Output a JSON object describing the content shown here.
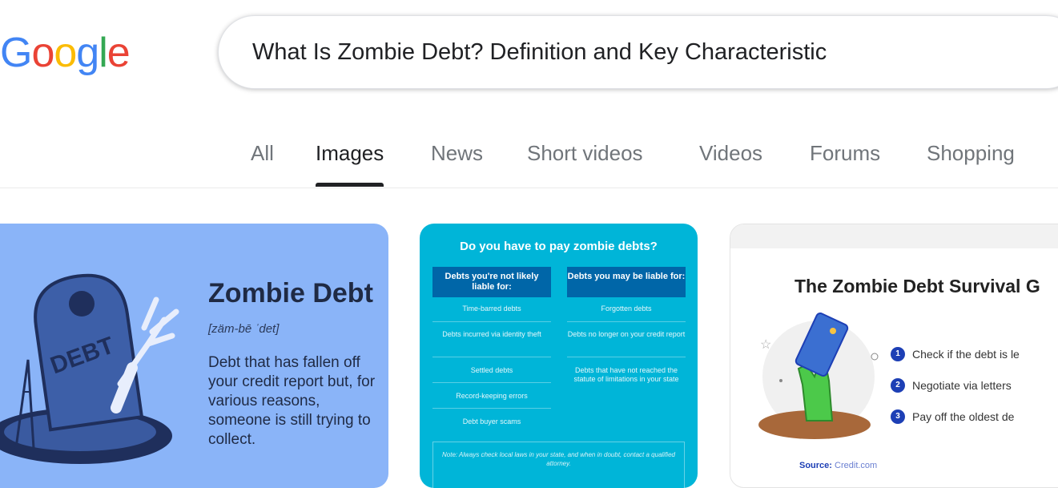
{
  "logo": {
    "b1": "G",
    "o1": "o",
    "o2": "o",
    "g": "g",
    "l": "l",
    "e": "e"
  },
  "search": {
    "query": "What Is Zombie Debt? Definition and Key Characteristic"
  },
  "tabs": [
    {
      "label": "All"
    },
    {
      "label": "Images"
    },
    {
      "label": "News"
    },
    {
      "label": "Short videos"
    },
    {
      "label": "Videos"
    },
    {
      "label": "Forums"
    },
    {
      "label": "Shopping"
    }
  ],
  "results": {
    "card1": {
      "title": "Zombie Debt",
      "pronunciation": "[zäm-bē ˈdet]",
      "definition": "Debt that has fallen off your credit report but, for various reasons, someone is still trying to collect.",
      "stone_label": "DEBT"
    },
    "card2": {
      "title": "Do you have to pay zombie debts?",
      "col1_header": "Debts you're not likely liable for:",
      "col2_header": "Debts you may be liable for:",
      "col1": [
        "Time-barred debts",
        "Debts incurred via identity theft",
        "Settled debts",
        "Record-keeping errors",
        "Debt buyer scams"
      ],
      "col2": [
        "Forgotten debts",
        "Debts no longer on your credit report",
        "Debts that have not reached the statute of limitations in your state"
      ],
      "note": "Note: Always check local laws in your state, and when in doubt, contact a qualified attorney."
    },
    "card3": {
      "title": "The Zombie Debt Survival G",
      "steps": [
        "Check if the debt is le",
        "Negotiate via letters",
        "Pay off the oldest de"
      ],
      "step_numbers": [
        "1",
        "2",
        "3"
      ],
      "source_label": "Source:",
      "source_value": "Credit.com"
    }
  }
}
